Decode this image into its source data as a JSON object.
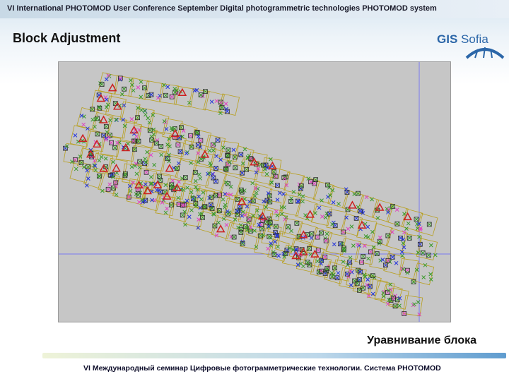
{
  "header": {
    "conference_text": "VI International PHOTOMOD User Conference September Digital photogrammetric technologies PHOTOMOD system"
  },
  "slide": {
    "title": "Block Adjustment",
    "caption_ru": "Уравнивание блока"
  },
  "logo": {
    "text_bold": "GIS",
    "text_regular": "Sofia"
  },
  "footer": {
    "text": "VI Международный семинар Цифровые фотограмметрические технологии. Система PHOTOMOD"
  },
  "colors": {
    "viewport_bg": "#c6c6c6",
    "frame_outline": "#b8a020",
    "tie_point_green": "#3a9a2a",
    "tie_point_blue": "#2233dd",
    "tie_point_magenta": "#e040c0",
    "control_point_red": "#cc2020",
    "axis_line": "#7a7af0"
  },
  "icons": [
    "tie-point-icon",
    "control-point-triangle-icon",
    "image-frame-icon"
  ]
}
